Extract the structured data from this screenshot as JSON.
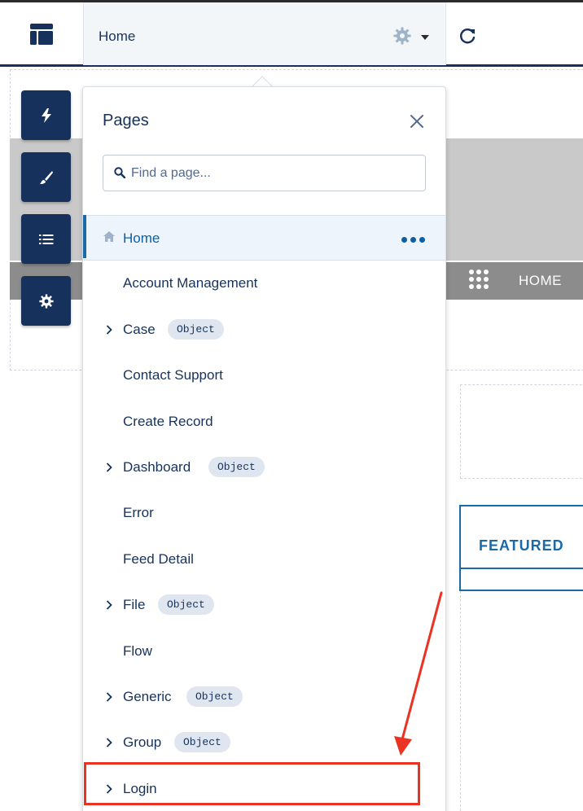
{
  "topbar": {
    "page_title": "Home",
    "icons": {
      "layout": "page-layout-icon",
      "settings": "gear-icon",
      "dropdown": "caret-down-icon",
      "refresh": "refresh-icon"
    }
  },
  "tools": [
    {
      "name": "components-tool",
      "icon": "lightning-icon"
    },
    {
      "name": "theme-tool",
      "icon": "brush-icon"
    },
    {
      "name": "page-structure-tool",
      "icon": "list-icon"
    },
    {
      "name": "settings-tool",
      "icon": "gear-icon"
    }
  ],
  "site_preview": {
    "nav_label": "HOME",
    "featured_label": "FEATURED"
  },
  "pages_panel": {
    "title": "Pages",
    "search_placeholder": "Find a page...",
    "items": [
      {
        "label": "Home",
        "selected": true,
        "expandable": false,
        "badge": null
      },
      {
        "label": "Account Management",
        "expandable": false,
        "badge": null
      },
      {
        "label": "Case",
        "expandable": true,
        "badge": "Object"
      },
      {
        "label": "Contact Support",
        "expandable": false,
        "badge": null
      },
      {
        "label": "Create Record",
        "expandable": false,
        "badge": null
      },
      {
        "label": "Dashboard",
        "expandable": true,
        "badge": "Object"
      },
      {
        "label": "Error",
        "expandable": false,
        "badge": null
      },
      {
        "label": "Feed Detail",
        "expandable": false,
        "badge": null
      },
      {
        "label": "File",
        "expandable": true,
        "badge": "Object"
      },
      {
        "label": "Flow",
        "expandable": false,
        "badge": null
      },
      {
        "label": "Generic",
        "expandable": true,
        "badge": "Object"
      },
      {
        "label": "Group",
        "expandable": true,
        "badge": "Object"
      },
      {
        "label": "Login",
        "expandable": true,
        "badge": null,
        "highlighted": true
      }
    ]
  },
  "colors": {
    "navy": "#16325c",
    "accent_blue": "#1b6aa8",
    "highlight_red": "#ea3323"
  }
}
